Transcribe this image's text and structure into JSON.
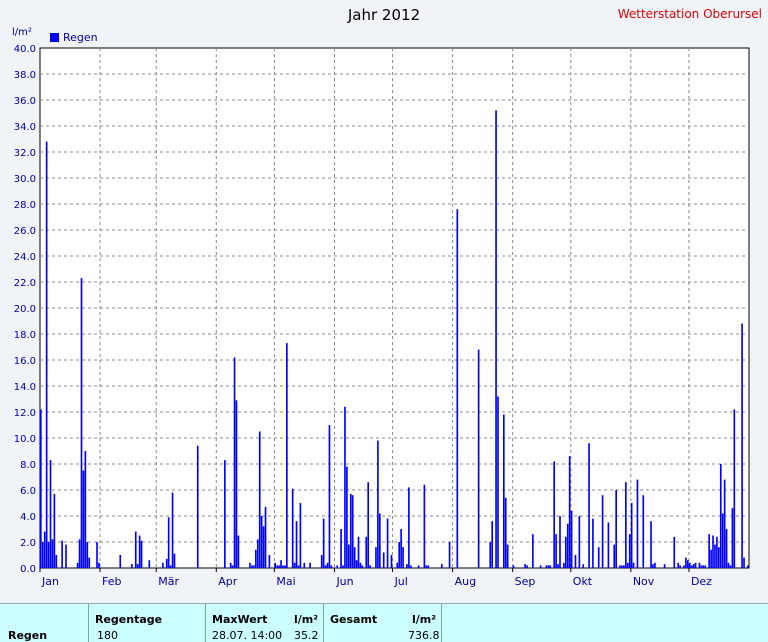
{
  "title": "Jahr 2012",
  "station": "Wetterstation Oberursel",
  "unit": "l/m²",
  "legend_label": "Regen",
  "colors": {
    "bar": "#0000ff",
    "axis_text": "#0000a0",
    "station": "#e00000",
    "footer_bg": "#ccffff"
  },
  "chart_data": {
    "type": "bar",
    "title": "Jahr 2012",
    "ylabel": "l/m²",
    "ylim": [
      0,
      40
    ],
    "y_ticks": [
      "0.0",
      "2.0",
      "4.0",
      "6.0",
      "8.0",
      "10.0",
      "12.0",
      "14.0",
      "16.0",
      "18.0",
      "20.0",
      "22.0",
      "24.0",
      "26.0",
      "28.0",
      "30.0",
      "32.0",
      "34.0",
      "36.0",
      "38.0",
      "40.0"
    ],
    "x_ticks": [
      "Jan",
      "Feb",
      "Mär",
      "Apr",
      "Mai",
      "Jun",
      "Jul",
      "Aug",
      "Sep",
      "Okt",
      "Nov",
      "Dez"
    ],
    "grid": true,
    "legend": "top-left",
    "series": [
      {
        "name": "Regen",
        "x_day": [
          1,
          2,
          3,
          4,
          5,
          6,
          7,
          8,
          9,
          12,
          14,
          20,
          21,
          22,
          23,
          24,
          25,
          26,
          30,
          31,
          42,
          48,
          50,
          51,
          52,
          53,
          57,
          64,
          66,
          67,
          68,
          69,
          70,
          82,
          96,
          99,
          100,
          101,
          102,
          103,
          109,
          110,
          111,
          112,
          113,
          114,
          115,
          116,
          117,
          119,
          122,
          123,
          124,
          125,
          126,
          127,
          128,
          131,
          132,
          133,
          134,
          135,
          137,
          140,
          146,
          147,
          148,
          149,
          150,
          151,
          154,
          156,
          157,
          158,
          159,
          160,
          161,
          162,
          163,
          164,
          165,
          166,
          167,
          169,
          170,
          171,
          174,
          175,
          176,
          178,
          180,
          182,
          185,
          186,
          187,
          188,
          190,
          191,
          192,
          196,
          199,
          200,
          201,
          208,
          212,
          216,
          227,
          233,
          234,
          236,
          237,
          240,
          241,
          242,
          245,
          251,
          252,
          255,
          259,
          262,
          263,
          264,
          266,
          267,
          268,
          269,
          271,
          272,
          273,
          274,
          275,
          277,
          279,
          281,
          284,
          286,
          289,
          291,
          294,
          297,
          298,
          300,
          301,
          302,
          303,
          304,
          305,
          306,
          307,
          309,
          312,
          316,
          317,
          318,
          323,
          328,
          330,
          331,
          333,
          334,
          335,
          336,
          337,
          338,
          339,
          341,
          342,
          343,
          344,
          346,
          347,
          348,
          349,
          350,
          351,
          352,
          353,
          354,
          355,
          356,
          357,
          358,
          359,
          363,
          364,
          366
        ],
        "values": [
          12.2,
          2.0,
          2.8,
          32.8,
          2.0,
          8.3,
          2.2,
          5.7,
          1.0,
          2.1,
          1.8,
          0.4,
          2.2,
          22.3,
          7.5,
          9.0,
          2.0,
          0.8,
          2.0,
          0.4,
          1.0,
          0.3,
          2.8,
          0.3,
          2.5,
          2.1,
          0.6,
          0.4,
          0.7,
          3.9,
          0.2,
          5.8,
          1.1,
          9.4,
          8.3,
          0.4,
          0.2,
          16.2,
          12.9,
          2.5,
          0.4,
          0.2,
          0.2,
          1.4,
          2.2,
          10.5,
          4.0,
          3.2,
          4.7,
          1.0,
          0.4,
          0.2,
          0.2,
          0.6,
          0.2,
          0.2,
          17.3,
          6.1,
          0.4,
          3.6,
          0.2,
          5.0,
          0.4,
          0.4,
          1.0,
          3.8,
          0.2,
          0.4,
          11.0,
          0.2,
          0.2,
          3.0,
          0.2,
          12.4,
          7.8,
          1.8,
          5.7,
          5.6,
          1.6,
          0.6,
          2.4,
          0.4,
          0.2,
          2.4,
          6.6,
          0.2,
          1.6,
          9.8,
          4.2,
          1.2,
          3.8,
          1.0,
          0.4,
          2.0,
          3.0,
          1.6,
          0.3,
          6.2,
          0.2,
          0.2,
          6.4,
          0.2,
          0.2,
          0.3,
          2.0,
          27.6,
          16.8,
          2.0,
          3.6,
          35.2,
          13.2,
          11.8,
          5.4,
          1.8,
          0.2,
          0.3,
          0.2,
          2.6,
          0.2,
          0.2,
          0.2,
          0.2,
          8.2,
          2.6,
          0.3,
          4.0,
          0.4,
          2.4,
          3.4,
          8.6,
          4.4,
          1.0,
          4.0,
          0.3,
          9.6,
          3.8,
          1.6,
          5.6,
          3.5,
          1.8,
          6.0,
          0.2,
          0.2,
          0.2,
          6.6,
          0.4,
          2.6,
          5.0,
          0.4,
          6.8,
          5.6,
          3.6,
          0.3,
          0.4,
          0.3,
          2.4,
          0.4,
          0.2,
          0.2,
          0.8,
          0.6,
          0.4,
          0.2,
          0.3,
          0.4,
          0.4,
          0.2,
          0.2,
          0.2,
          2.6,
          1.4,
          2.5,
          1.8,
          2.4,
          1.6,
          8.0,
          4.2,
          6.8,
          3.0,
          0.4,
          0.2,
          4.6,
          12.2,
          18.8,
          0.8,
          0.2,
          3.4,
          11.7,
          0.4,
          0.8
        ]
      }
    ]
  },
  "footer": {
    "row_label": "Regen",
    "regentage_label": "Regentage",
    "regentage_value": "180",
    "maxwert_label": "MaxWert",
    "maxwert_unit": "l/m²",
    "maxwert_date": "28.07.  14:00",
    "maxwert_value": "35.2",
    "gesamt_label": "Gesamt",
    "gesamt_unit": "l/m²",
    "gesamt_value": "736.8"
  }
}
